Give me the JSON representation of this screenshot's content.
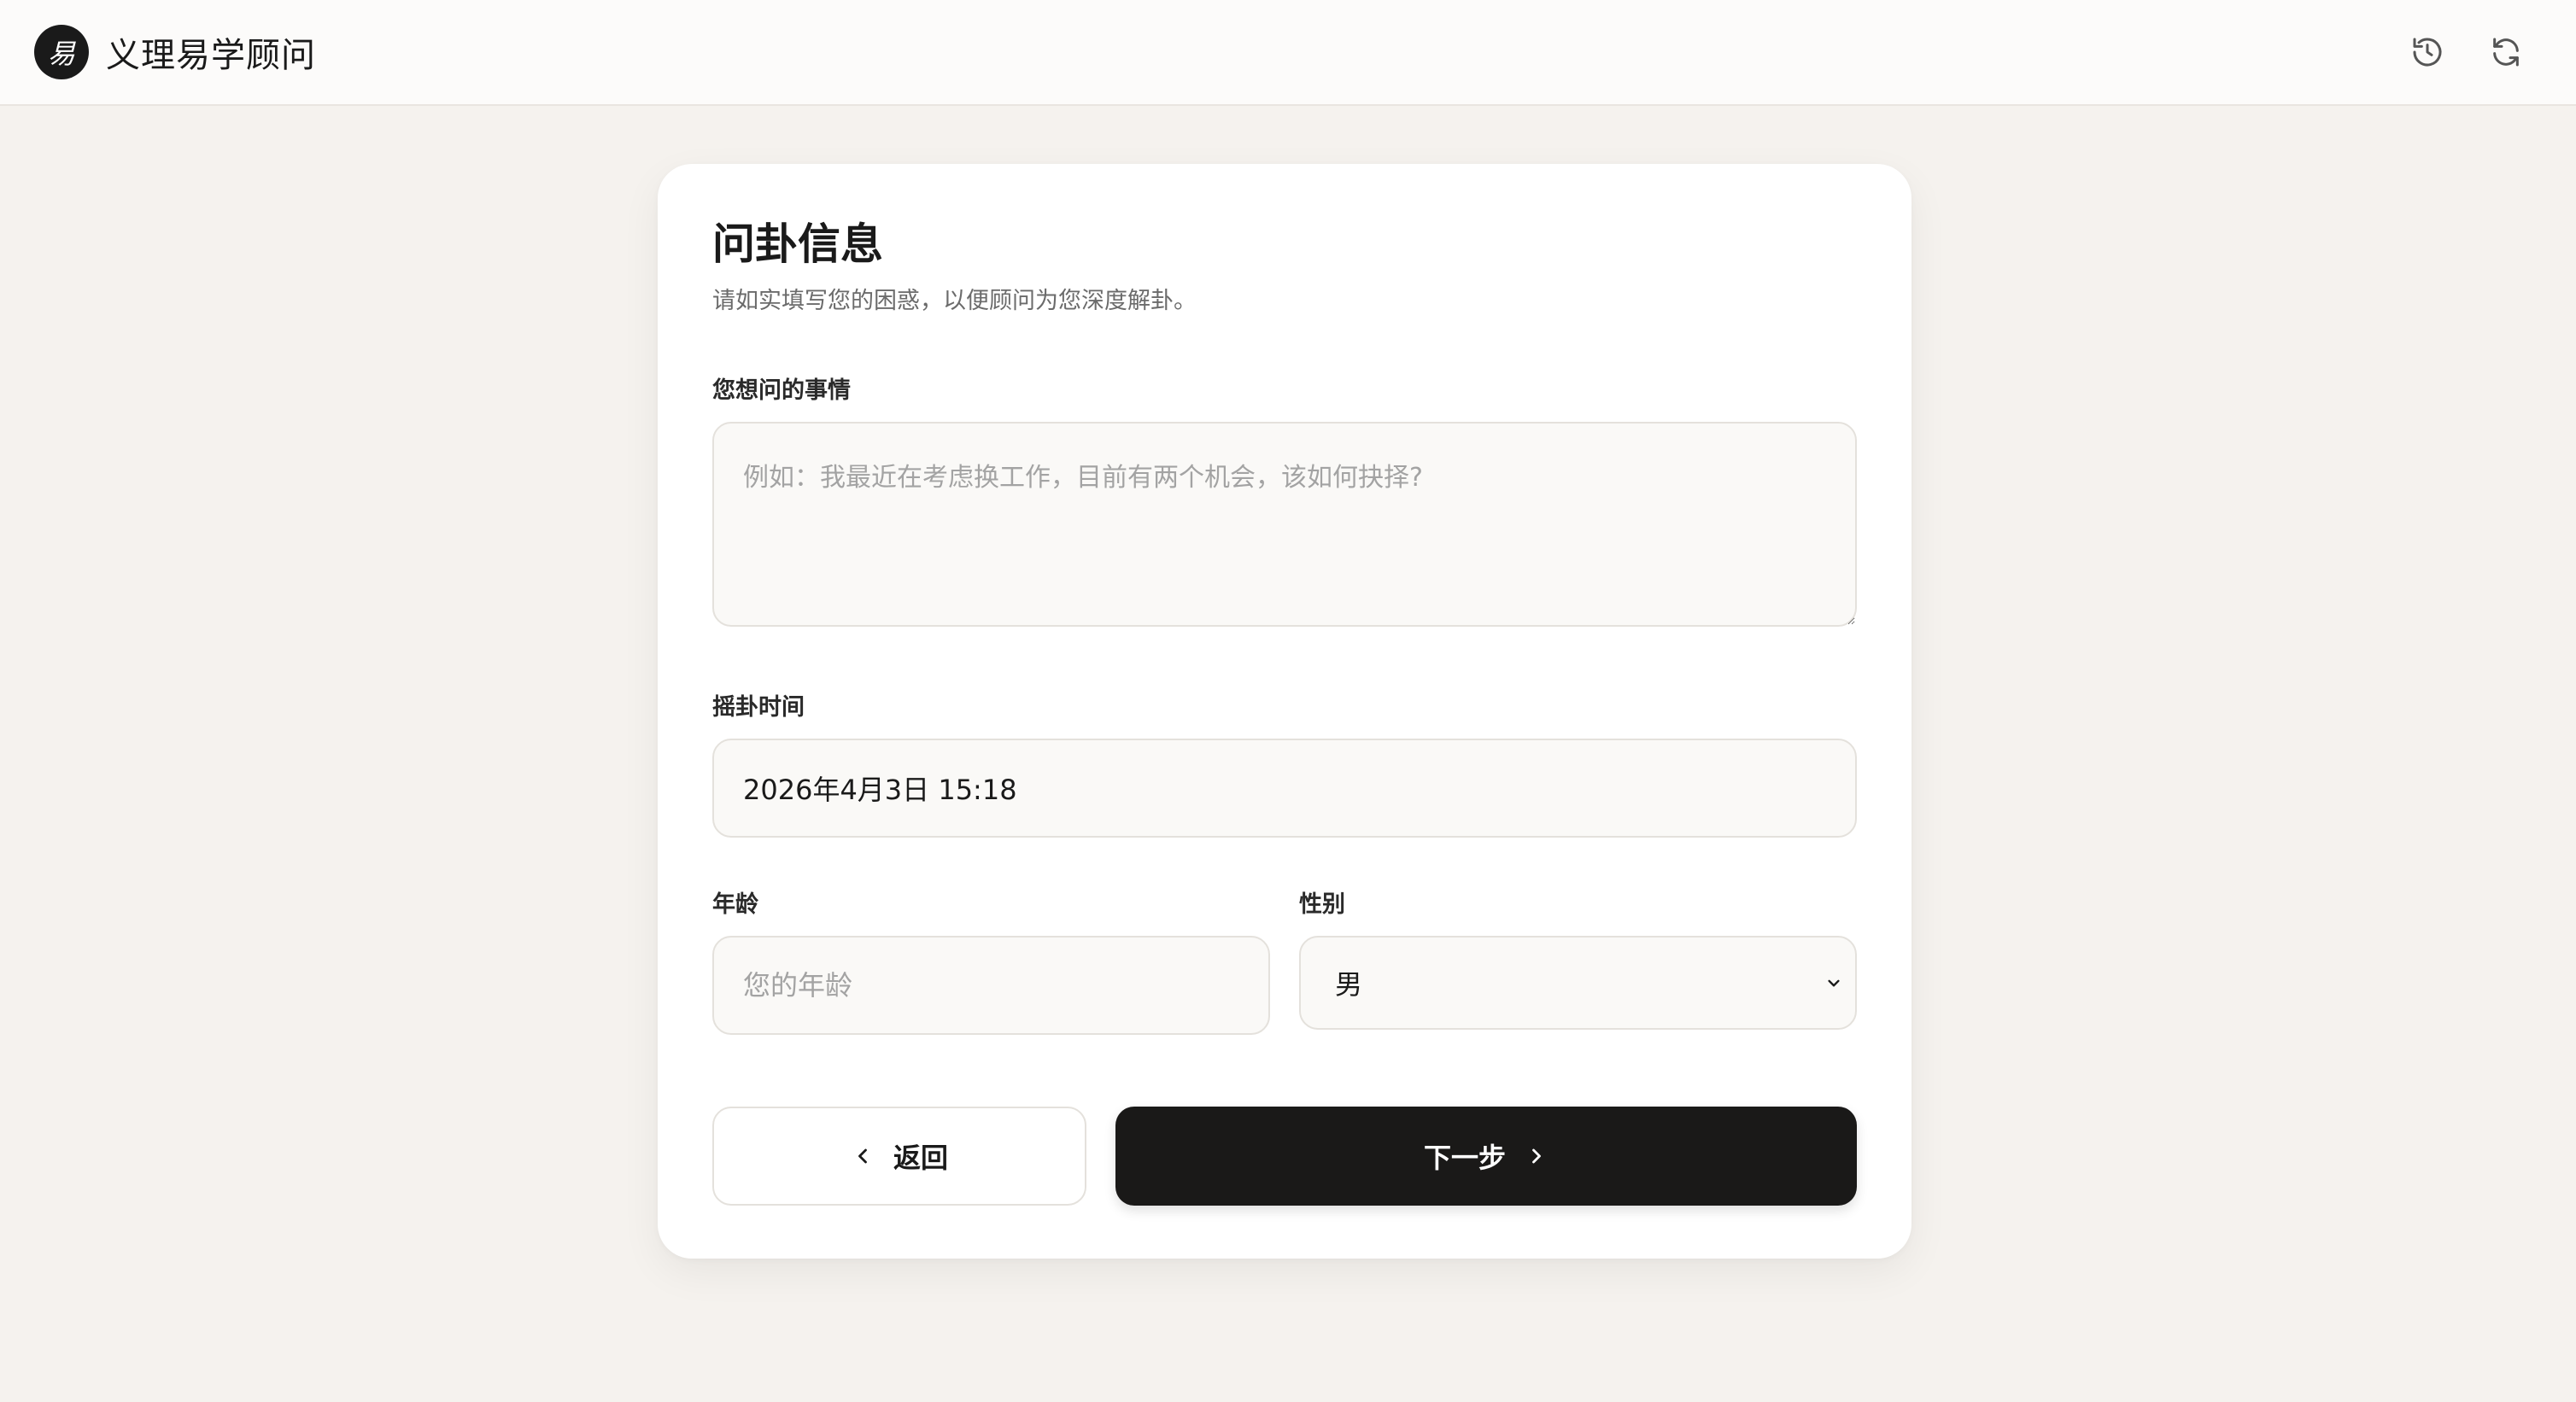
{
  "header": {
    "logo_glyph": "易",
    "title": "义理易学顾问",
    "history_icon": "history-icon",
    "refresh_icon": "refresh-icon"
  },
  "form": {
    "title": "问卦信息",
    "subtitle": "请如实填写您的困惑，以便顾问为您深度解卦。",
    "question": {
      "label": "您想问的事情",
      "value": "",
      "placeholder": "例如：我最近在考虑换工作，目前有两个机会，该如何抉择?"
    },
    "time": {
      "label": "摇卦时间",
      "value": "2026年4月3日 15:18"
    },
    "age": {
      "label": "年龄",
      "value": "",
      "placeholder": "您的年龄"
    },
    "gender": {
      "label": "性别",
      "value": "男"
    },
    "back_label": "返回",
    "next_label": "下一步"
  },
  "colors": {
    "background": "#f5f2ee",
    "primary_button": "#1a1918",
    "card": "#ffffff"
  }
}
